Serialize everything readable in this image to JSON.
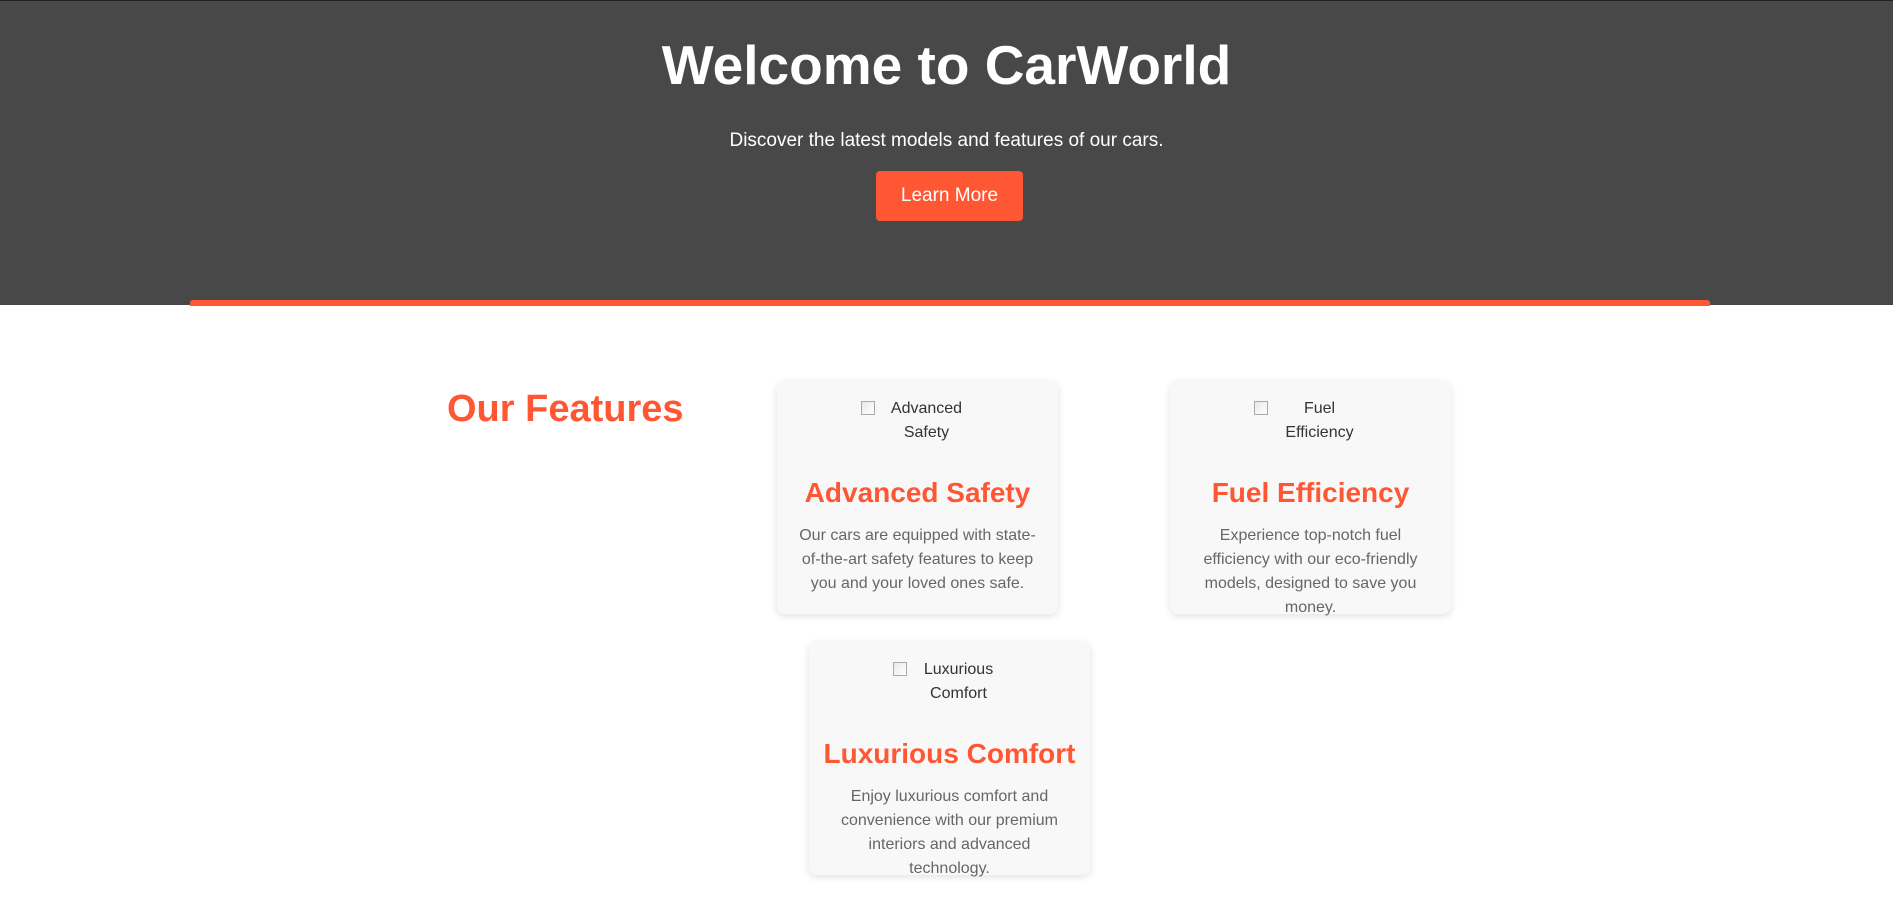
{
  "hero": {
    "title": "Welcome to CarWorld",
    "subtitle": "Discover the latest models and features of our cars.",
    "button_label": "Learn More"
  },
  "features": {
    "title": "Our Features",
    "cards": [
      {
        "image_alt": "Advanced Safety",
        "title": "Advanced Safety",
        "description": "Our cars are equipped with state-of-the-art safety features to keep you and your loved ones safe."
      },
      {
        "image_alt": "Fuel Efficiency",
        "title": "Fuel Efficiency",
        "description": "Experience top-notch fuel efficiency with our eco-friendly models, designed to save you money."
      },
      {
        "image_alt": "Luxurious Comfort",
        "title": "Luxurious Comfort",
        "description": "Enjoy luxurious comfort and convenience with our premium interiors and advanced technology."
      }
    ]
  },
  "colors": {
    "accent": "#ff5733",
    "hero_background": "#484848",
    "card_background": "#f8f8f8"
  },
  "icons": {
    "card_image": "broken-image-icon"
  }
}
